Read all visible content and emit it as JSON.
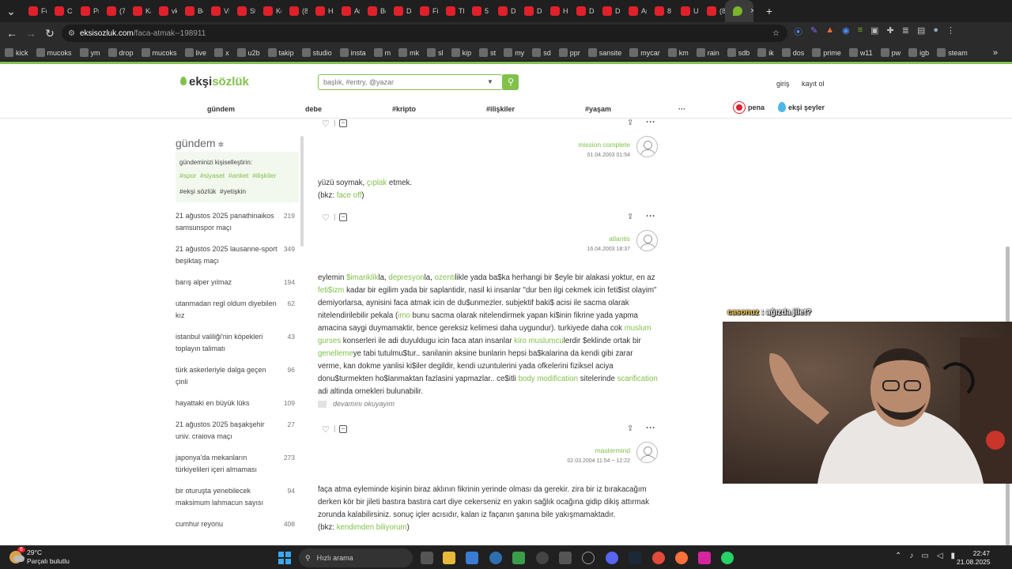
{
  "browser": {
    "tabs": [
      "Fo",
      "Ca",
      "Pr",
      "(7",
      "Ka",
      "vk",
      "Be",
      "VL",
      "St",
      "Kc",
      "(8",
      "Ha",
      "Ar",
      "Be",
      "DJ",
      "Fil",
      "Th",
      "5",
      "DJ",
      "DJ",
      "Ho",
      "DJ",
      "Di",
      "Ar",
      "8",
      "UI",
      "(8"
    ],
    "new_tab_glyph": "+",
    "url_domain": "eksisozluk.com",
    "url_path": "/faca-atmak--198911",
    "bookmarks": [
      "kick",
      "mucoks",
      "ym",
      "drop",
      "mucoks",
      "live",
      "x",
      "u2b",
      "takip",
      "studio",
      "insta",
      "m",
      "mk",
      "sl",
      "kip",
      "st",
      "my",
      "sd",
      "ppr",
      "sansite",
      "mycar",
      "km",
      "rain",
      "sdb",
      "ik",
      "dos",
      "prime",
      "w11",
      "pw",
      "igb",
      "steam"
    ]
  },
  "site": {
    "logo_a": "ekşi",
    "logo_b": "sözlük",
    "search_placeholder": "başlık, #entry, @yazar",
    "login": "giriş",
    "register": "kayıt ol",
    "nav": [
      "gündem",
      "debe",
      "#kripto",
      "#ilişkiler",
      "#yaşam",
      "···"
    ],
    "pena": "pena",
    "eksiseyler": "ekşi şeyler",
    "accent_color": "#81c14b"
  },
  "sidebar": {
    "title": "gündem",
    "personalize_label": "gündeminizi kişiselleştirin:",
    "tags": "#spor  #siyaset  #anket  #ilişkiler",
    "tags2": "#ekşi sözlük  #yetişkin",
    "items": [
      {
        "title": "21 ağustos 2025 panathinaikos samsunspor maçı",
        "count": "219"
      },
      {
        "title": "21 ağustos 2025 lausanne-sport beşiktaş maçı",
        "count": "349"
      },
      {
        "title": "barış alper yılmaz",
        "count": "194"
      },
      {
        "title": "utanmadan regl oldum diyebilen kız",
        "count": "62"
      },
      {
        "title": "istanbul valiliği'nin köpekleri toplayın talimatı",
        "count": "43"
      },
      {
        "title": "türk askerleriyle dalga geçen çinli",
        "count": "96"
      },
      {
        "title": "hayattaki en büyük lüks",
        "count": "109"
      },
      {
        "title": "21 ağustos 2025 başakşehir univ. craiova maçı",
        "count": "27"
      },
      {
        "title": "japonya'da mekanların türkiyelileri içeri almaması",
        "count": "273"
      },
      {
        "title": "bir oturuşta yenebilecek maksimum lahmacun sayısı",
        "count": "94"
      },
      {
        "title": "cumhur reyonu",
        "count": "408"
      }
    ]
  },
  "entries": [
    {
      "author": "mission complete",
      "date": "01.04.2003 01:54"
    },
    {
      "author": "atlantis",
      "date": "16.04.2003 18:37"
    },
    {
      "author": "mastermind",
      "date": "02.03.2004 11:54 ~ 12:22"
    }
  ],
  "entry1": {
    "t1": "yüzü soymak, ",
    "l1": "çıplak",
    "t2": " etmek.",
    "t3": "(bkz: ",
    "l2": "face off",
    "t4": ")"
  },
  "entry2": {
    "p0": "eylemin ",
    "l0": "$imariklik",
    "p1": "la, ",
    "l1": "depresyon",
    "p2": "la, ",
    "l2": "ozenti",
    "p3": "likle yada ba$ka herhangi bir $eyle bir alakasi yoktur, en az ",
    "l3": "feti$izm",
    "p4": " kadar bir egilim yada bir saplantidir, nasil ki insanlar \"dur ben ilgi cekmek icin feti$ist olayim\" demiyorlarsa, aynisini faca atmak icin de du$unmezler. subjektif baki$ acisi ile sacma olarak nitelendirilebilir pekala (",
    "l4": "imo",
    "p5": " bunu sacma olarak nitelendirmek yapan ki$inin fikrine yada yapma amacina saygi duymamaktir, bence gereksiz kelimesi daha uygundur). turkiyede daha cok ",
    "l5": "muslum gurses",
    "p6": " konserleri ile adi duyuldugu icin faca atan insanlar ",
    "l6": "kiro muslumcu",
    "p7": "lerdir $eklinde ortak bir ",
    "l7": "genelleme",
    "p8": "ye tabi tutulmu$tur.. sanilanin aksine bunlarin hepsi ba$kalarina da kendi gibi zarar verme, kan dokme yanlisi ki$iler degildir, kendi uzuntulerini yada ofkelerini fiziksel aciya donu$turmekten ho$lanmaktan fazlasini yapmazlar.. ce$itli ",
    "l8": "body modification",
    "p9": " sitelerinde ",
    "l9": "scarification",
    "p10": " adi altinda ornekleri bulunabilir.",
    "readmore": "devamını okuyayım"
  },
  "entry3": {
    "t1": "faça atma eyleminde kişinin biraz aklının fikrinin yerinde olması da gerekir. zira bir iz bırakacağım derken kör bir jileti bastıra bastıra cart diye cekerseniz en yakın sağlık ocağına gidip dikiş attırmak zorunda kalabilirsiniz. sonuç içler acısıdır, kalan iz façanın şanına bile yakışmamaktadır.",
    "t2": "(bkz: ",
    "l1": "kendimden biliyorum",
    "t3": ")"
  },
  "overlay": {
    "user": "casonuz",
    "sep": " : ",
    "text": "ağızda jilet?"
  },
  "taskbar": {
    "temp": "29°C",
    "weather": "Parçalı bulutlu",
    "badge": "6",
    "search": "Hızlı arama",
    "time": "22:47",
    "date": "21.08.2025"
  }
}
